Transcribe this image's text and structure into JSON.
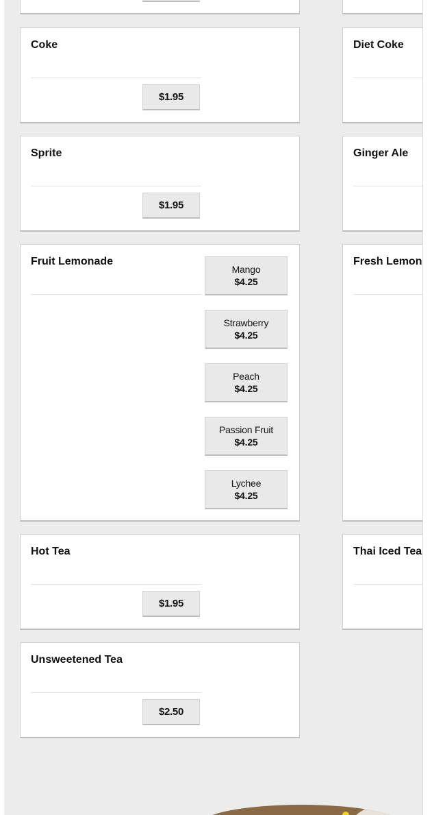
{
  "left_cards": {
    "coke": {
      "title": "Coke",
      "price": "$1.95"
    },
    "sprite": {
      "title": "Sprite",
      "price": "$1.95"
    },
    "fruit_lemonade": {
      "title": "Fruit Lemonade",
      "options": [
        {
          "name": "Mango",
          "price": "$4.25"
        },
        {
          "name": "Strawberry",
          "price": "$4.25"
        },
        {
          "name": "Peach",
          "price": "$4.25"
        },
        {
          "name": "Passion Fruit",
          "price": "$4.25"
        },
        {
          "name": "Lychee",
          "price": "$4.25"
        }
      ]
    },
    "hot_tea": {
      "title": "Hot Tea",
      "price": "$1.95"
    },
    "unsweetened_tea": {
      "title": "Unsweetened Tea",
      "price": "$2.50"
    }
  },
  "right_cards": {
    "diet_coke": {
      "title": "Diet Coke"
    },
    "ginger_ale": {
      "title": "Ginger Ale"
    },
    "fresh_lemonade": {
      "title": "Fresh Lemonade"
    },
    "thai_iced_tea": {
      "title": "Thai Iced Tea"
    }
  }
}
